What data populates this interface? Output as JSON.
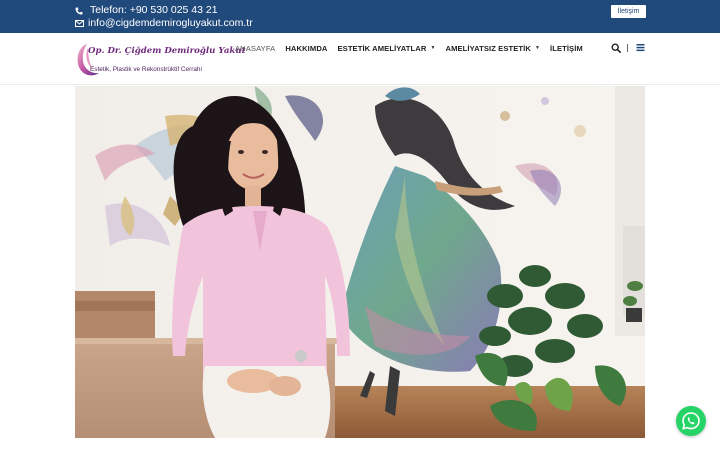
{
  "topbar": {
    "phone": "Telefon: +90 530 025 43 21",
    "email": "info@cigdemdemirogluyakut.com.tr",
    "button_label": "İletişim"
  },
  "logo": {
    "line1": "Op. Dr. Çiğdem Demiroğlu Yakut",
    "line2": "Estetik, Plastik ve Rekonstrüktif Cerrahi"
  },
  "nav": {
    "items": [
      {
        "label": "ANASAYFA"
      },
      {
        "label": "HAKKIMDA"
      },
      {
        "label": "ESTETİK AMELİYATLAR"
      },
      {
        "label": "AMELİYATSIZ ESTETİK"
      },
      {
        "label": "İLETİŞİM"
      }
    ]
  },
  "colors": {
    "topbar": "#214a7c",
    "whatsapp": "#25d366",
    "logo_purple": "#6f2a7d"
  },
  "icons": {
    "phone": "phone-icon",
    "email": "envelope-icon",
    "search": "search-icon",
    "menu": "hamburger-menu-icon",
    "whatsapp": "whatsapp-icon"
  }
}
